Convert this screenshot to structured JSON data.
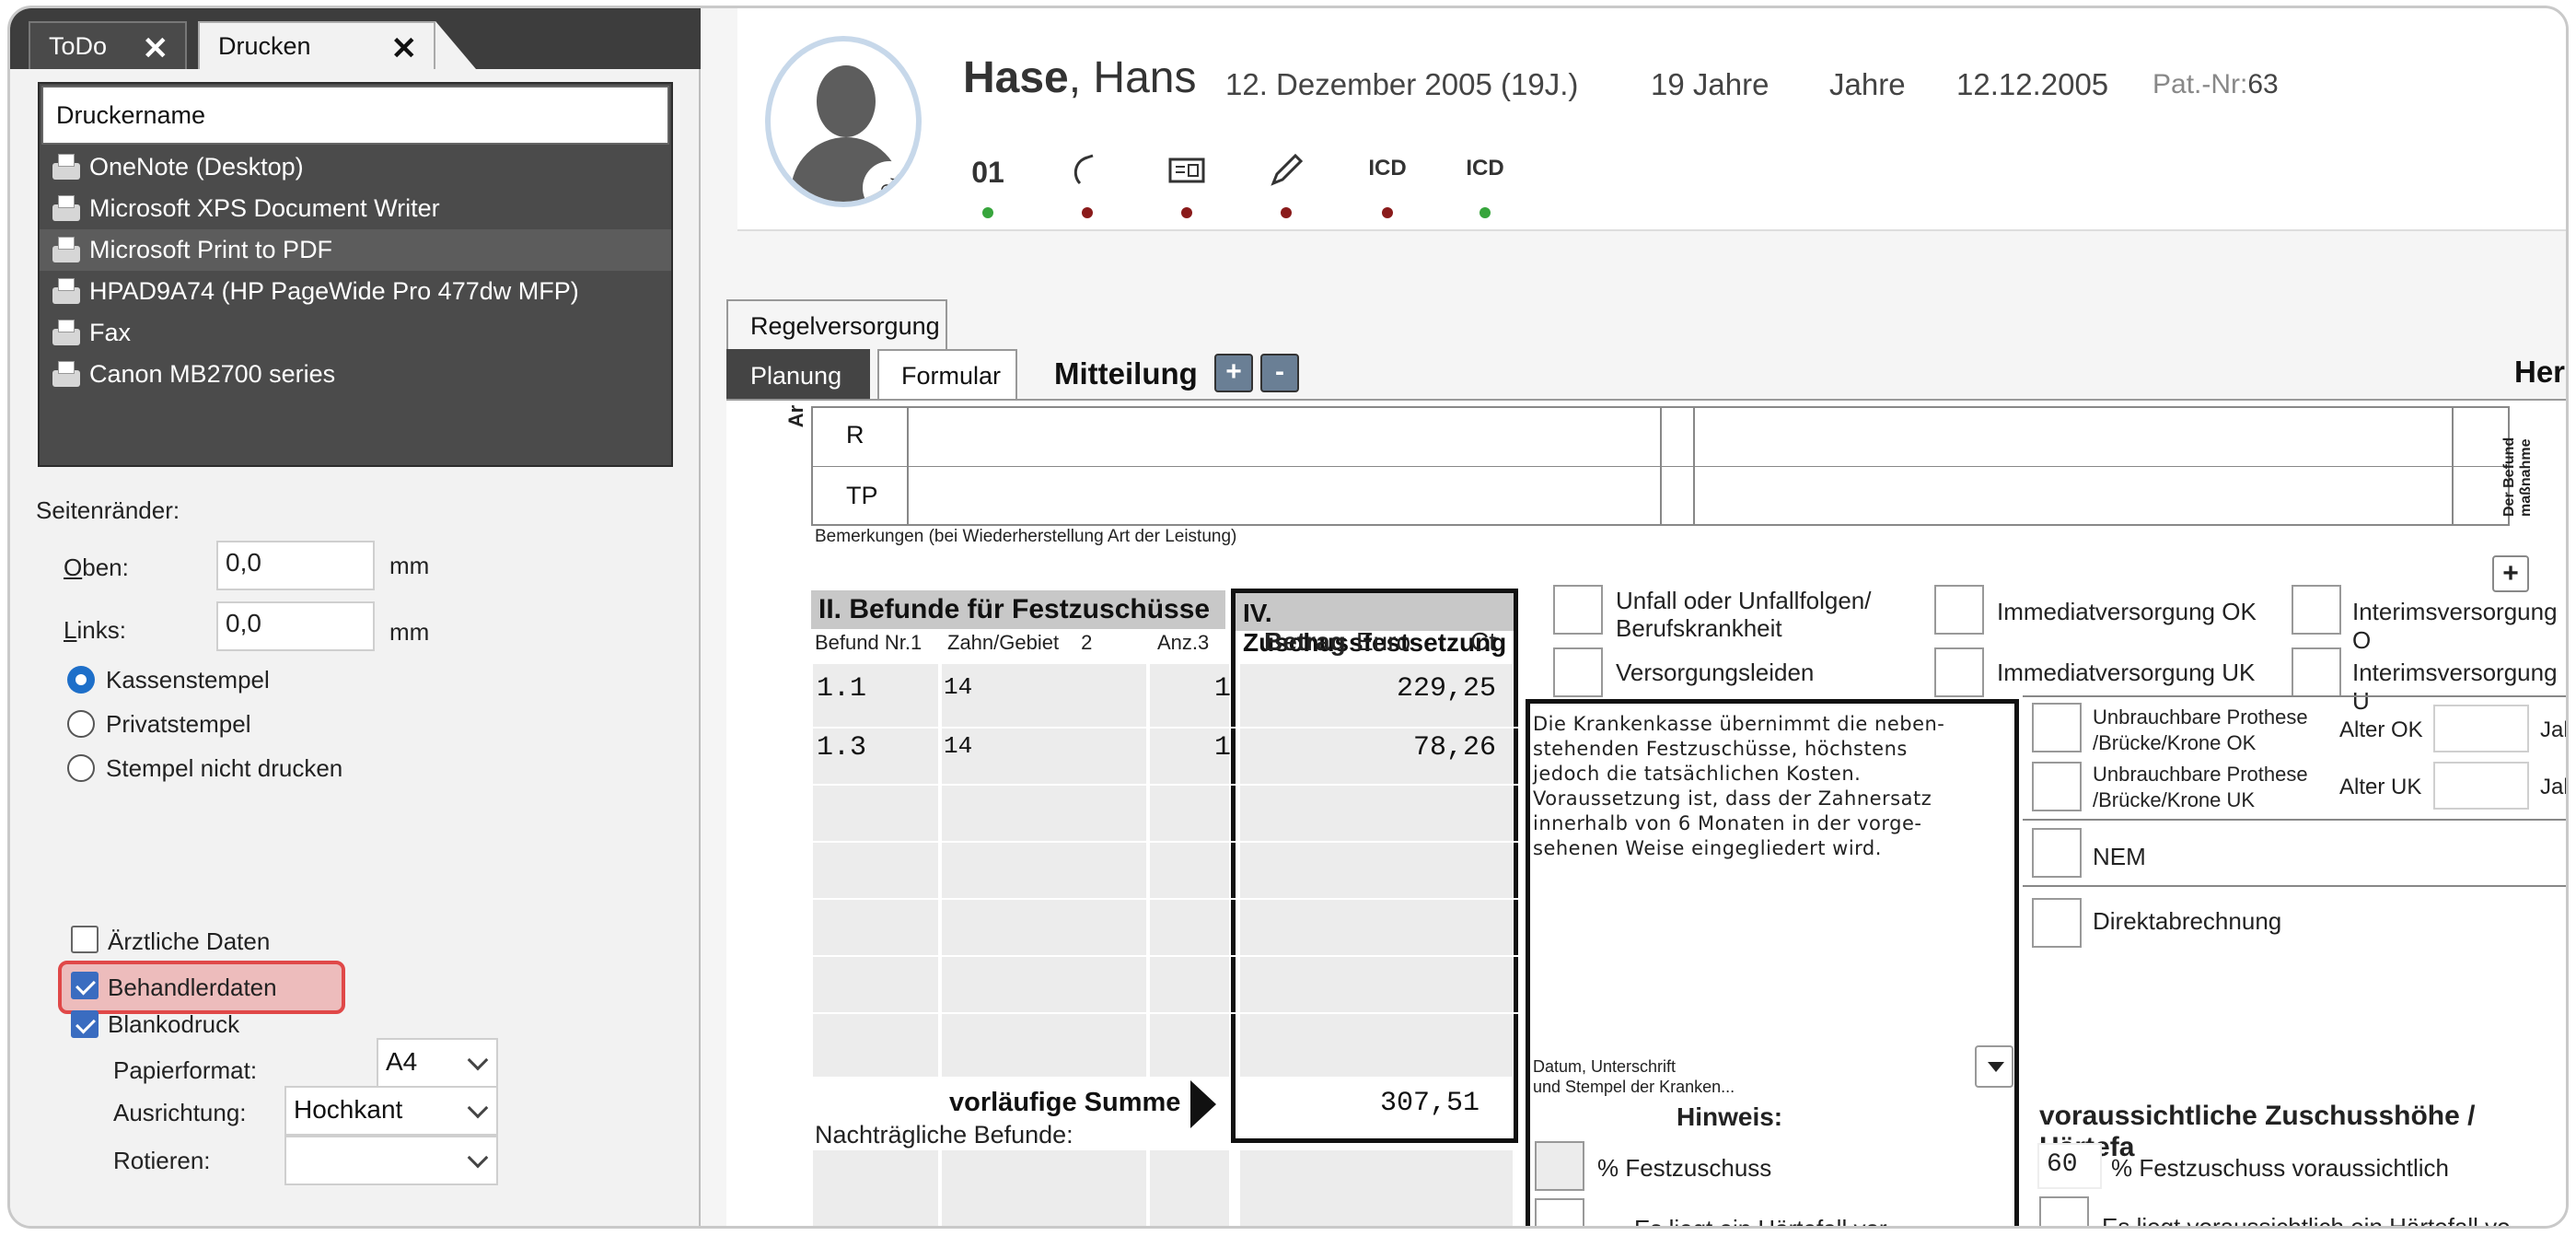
{
  "tabs": {
    "todo": "ToDo",
    "drucken": "Drucken",
    "close_glyph": "✕"
  },
  "printer_list": {
    "header": "Druckername",
    "items": [
      "OneNote (Desktop)",
      "Microsoft XPS Document Writer",
      "Microsoft Print to PDF",
      "HPAD9A74 (HP PageWide Pro 477dw MFP)",
      "Fax",
      "Canon MB2700 series"
    ],
    "selected": "Microsoft Print to PDF"
  },
  "margins": {
    "title": "Seitenränder:",
    "top_label_u": "O",
    "top_label_rest": "ben:",
    "top_value": "0,0",
    "top_unit": "mm",
    "left_label_u": "L",
    "left_label_rest": "inks:",
    "left_value": "0,0",
    "left_unit": "mm"
  },
  "stamp": {
    "options": [
      "Kassenstempel",
      "Privatstempel",
      "Stempel nicht drucken"
    ],
    "selected": "Kassenstempel"
  },
  "checks": {
    "aerztliche": {
      "label": "Ärztliche Daten",
      "checked": false
    },
    "behandler": {
      "label": "Behandlerdaten",
      "checked": true
    },
    "blanko": {
      "label": "Blankodruck",
      "checked": true
    }
  },
  "paper": {
    "format_label": "Papierformat:",
    "format_value": "A4",
    "orient_label": "Ausrichtung:",
    "orient_value": "Hochkant",
    "rotate_label": "Rotieren:",
    "rotate_value": ""
  },
  "patient": {
    "last": "Hase",
    "first": ", Hans",
    "birth": "12. Dezember 2005 (19J.)",
    "age": "19 Jahre",
    "age2": "Jahre",
    "date": "12.12.2005",
    "patnr_label": "Pat.-Nr:",
    "patnr": "63",
    "icons": [
      {
        "name": "01",
        "dot": "green"
      },
      {
        "name": "phone-icon",
        "dot": "red"
      },
      {
        "name": "card-icon",
        "dot": "red"
      },
      {
        "name": "pencil-icon",
        "dot": "red"
      },
      {
        "name": "ICD",
        "dot": "red"
      },
      {
        "name": "ICD",
        "dot": "green"
      }
    ]
  },
  "form_tabs": {
    "regelversorgung": "Regelversorgung",
    "planung": "Planung",
    "formular": "Formular",
    "mitteilung": "Mitteilung",
    "plus": "+",
    "minus": "-",
    "hers": "Hers"
  },
  "grid": {
    "ar": "Ar",
    "rows": [
      "R",
      "TP"
    ],
    "side": "Der Befund maßnahme",
    "bemerkungen": "Bemerkungen (bei Wiederherstellung Art der Leistung)"
  },
  "befunde": {
    "title": "II. Befunde für Festzuschüsse",
    "zus_title": "IV. Zuschussfestsetzung",
    "col_nr": "Befund Nr.",
    "col_nr_n": "1",
    "col_zahn": "Zahn/Gebiet",
    "col_zahn_n": "2",
    "col_anz": "Anz.",
    "col_anz_n": "3",
    "col_betrag": "Betrag",
    "col_euro": "Euro",
    "col_ct": "Ct",
    "rows": [
      {
        "nr": "1.1",
        "zahn": "14",
        "anz": "1",
        "betrag": "229,25"
      },
      {
        "nr": "1.3",
        "zahn": "14",
        "anz": "1",
        "betrag": "78,26"
      }
    ],
    "sum_label": "vorläufige Summe",
    "sum_value": "307,51",
    "nachtraeglich": "Nachträgliche Befunde:"
  },
  "options_mid": {
    "unfall": "Unfall oder Unfallfolgen/\nBerufskrankheit",
    "versorgungsleiden": "Versorgungsleiden",
    "imm_ok": "Immediatversorgung OK",
    "imm_uk": "Immediatversorgung UK",
    "int_ok": "Interimsversorgung O",
    "int_uk": "Interimsversorgung U"
  },
  "kasse_text": "Die Krankenkasse übernimmt die neben-\nstehenden Festzuschüsse, höchstens\njedoch die tatsächlichen Kosten.\nVoraussetzung ist, dass der Zahnersatz\ninnerhalb von 6 Monaten in der vorge-\nsehenen Weise eingegliedert wird.",
  "kasse_sign": "Datum, Unterschrift\nund Stempel der Kranken...",
  "hinweis": {
    "title": "Hinweis:",
    "festzuschuss": "% Festzuschuss",
    "haertefall": "Es liegt ein Härtefall vor."
  },
  "right_opts": {
    "ok": "Unbrauchbare Prothese\n/Brücke/Krone OK",
    "alter_ok": "Alter OK",
    "jah1": "Jah",
    "uk": "Unbrauchbare Prothese\n/Brücke/Krone UK",
    "alter_uk": "Alter UK",
    "jah2": "Jah",
    "nem": "NEM",
    "direkt": "Direktabrechnung",
    "vor_title": "voraussichtliche Zuschusshöhe / Härtefa",
    "vor_value": "60",
    "vor_label": "% Festzuschuss voraussichtlich",
    "vor_haerte": "Es liegt voraussichtlich ein Härtefall vo"
  }
}
